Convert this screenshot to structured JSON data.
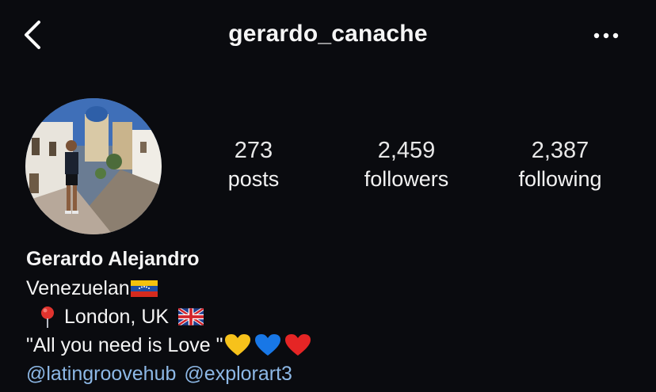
{
  "header": {
    "username": "gerardo_canache",
    "back_icon": "chevron-left-icon",
    "more_icon": "more-horizontal-icon"
  },
  "stats": {
    "posts": {
      "value": "273",
      "label": "posts"
    },
    "followers": {
      "value": "2,459",
      "label": "followers"
    },
    "following": {
      "value": "2,387",
      "label": "following"
    }
  },
  "bio": {
    "name": "Gerardo Alejandro",
    "line1": "Venezuelan",
    "line2": "London, UK",
    "line3": "\"All you need is Love \"",
    "links": [
      "@latingroovehub",
      "@explorart3"
    ]
  },
  "colors": {
    "background": "#0a0b0f",
    "link": "#8db8e6",
    "text": "#f5f5f5"
  }
}
